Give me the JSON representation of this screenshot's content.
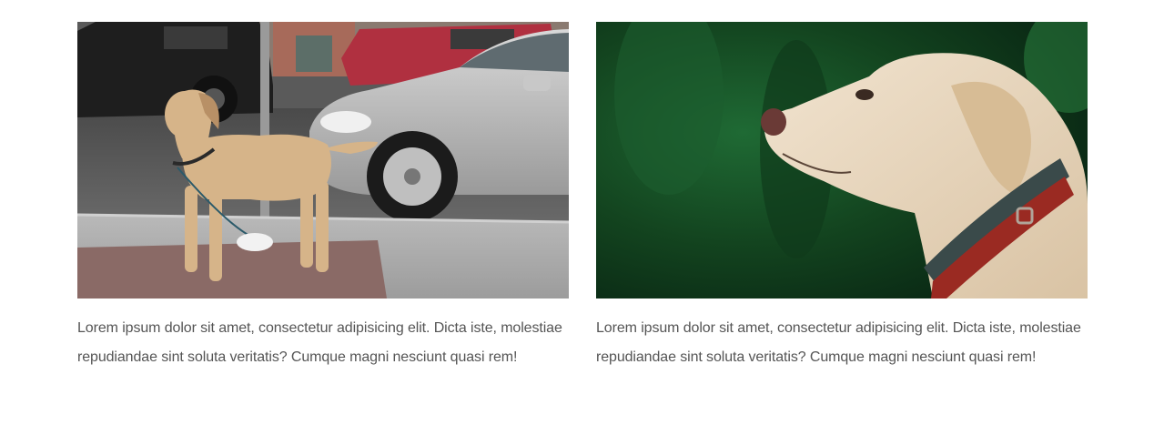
{
  "cards": [
    {
      "image_alt": "Labrador standing on sidewalk next to parked cars",
      "text": "Lorem ipsum dolor sit amet, consectetur adipisicing elit. Dicta iste, molestiae repudiandae sint soluta veritatis? Cumque magni nesciunt quasi rem!"
    },
    {
      "image_alt": "Close-up profile of a Labrador wearing a collar",
      "text": "Lorem ipsum dolor sit amet, consectetur adipisicing elit. Dicta iste, molestiae repudiandae sint soluta veritatis? Cumque magni nesciunt quasi rem!"
    }
  ],
  "colors": {
    "caption_text": "#555555",
    "background": "#ffffff"
  }
}
